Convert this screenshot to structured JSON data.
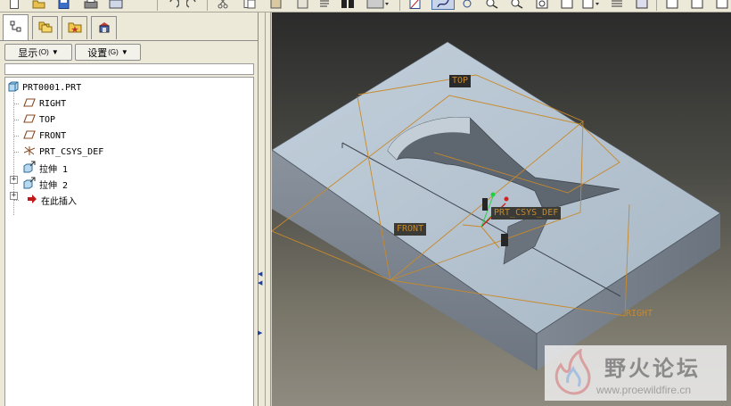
{
  "toolbar": {
    "icons": [
      "new-icon",
      "open-icon",
      "save-icon",
      "print-icon",
      "email-icon",
      "undo-icon",
      "redo-icon",
      "cut-icon",
      "copy-icon",
      "paste-icon",
      "paste-special-icon",
      "regenerate-icon",
      "find-icon",
      "select-box-icon",
      "sketch-icon",
      "spline-icon",
      "spin-icon",
      "zoom-in-icon",
      "zoom-out-icon",
      "refit-icon",
      "reorient-icon",
      "saved-views-icon",
      "layers-icon",
      "display-style-icon",
      "shaded-icon",
      "hidden-line-icon"
    ]
  },
  "panel": {
    "tabs": [
      {
        "name": "model-tree-tab",
        "icon": "tree-icon"
      },
      {
        "name": "folder-browser-tab",
        "icon": "folders-icon"
      },
      {
        "name": "favorites-tab",
        "icon": "favorites-icon"
      },
      {
        "name": "connections-tab",
        "icon": "connections-icon"
      }
    ],
    "show_menu": {
      "label": "显示",
      "shortcut": "(O)"
    },
    "settings_menu": {
      "label": "设置",
      "shortcut": "(G)"
    }
  },
  "tree": {
    "root": "PRT0001.PRT",
    "items": [
      {
        "label": "RIGHT",
        "icon": "datum-plane-icon"
      },
      {
        "label": "TOP",
        "icon": "datum-plane-icon"
      },
      {
        "label": "FRONT",
        "icon": "datum-plane-icon"
      },
      {
        "label": "PRT_CSYS_DEF",
        "icon": "csys-icon"
      },
      {
        "label": "拉伸 1",
        "icon": "extrude-icon"
      },
      {
        "label": "拉伸 2",
        "icon": "extrude-icon"
      },
      {
        "label": "在此插入",
        "icon": "insert-arrow-icon"
      }
    ]
  },
  "viewport": {
    "labels": {
      "top": "TOP",
      "front": "FRONT",
      "right": "RIGHT",
      "csys": "PRT_CSYS_DEF"
    }
  },
  "watermark": {
    "title": "野火论坛",
    "url": "www.proewildfire.cn"
  }
}
